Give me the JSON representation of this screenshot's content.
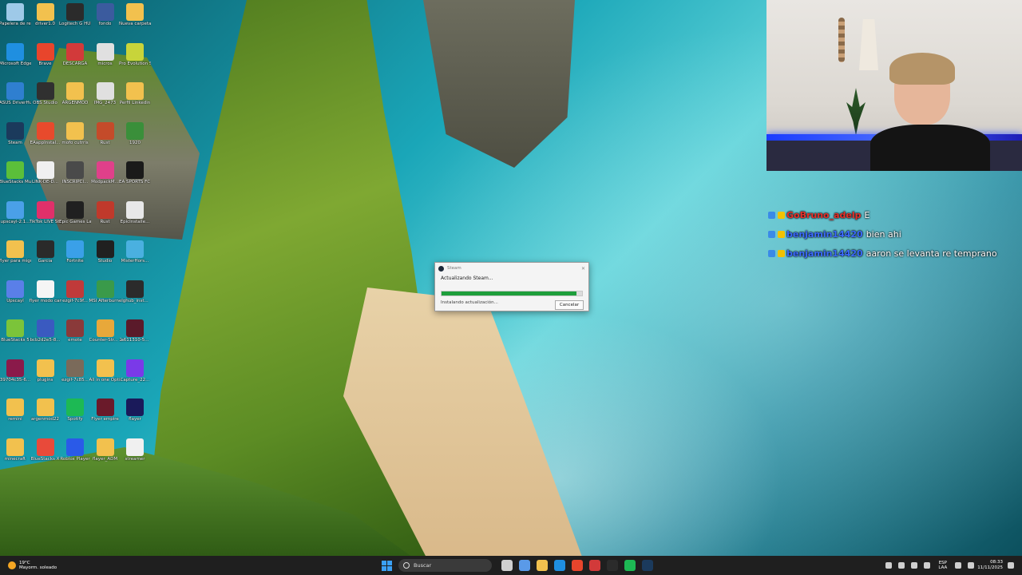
{
  "desktop": {
    "icons": [
      {
        "label": "Papelera de reciclaje",
        "color": "#9ec9e8"
      },
      {
        "label": "driver1.0",
        "color": "#f2c14e"
      },
      {
        "label": "Logitech G HUB",
        "color": "#2b2b2b"
      },
      {
        "label": "fondo",
        "color": "#3b5b9e"
      },
      {
        "label": "Nueva carpeta",
        "color": "#f2c14e"
      },
      {
        "label": "Microsoft Edge",
        "color": "#1f8fe0"
      },
      {
        "label": "Brave",
        "color": "#e8452c"
      },
      {
        "label": "DESCARGA",
        "color": "#d23a3a"
      },
      {
        "label": "micros",
        "color": "#e0e0e0"
      },
      {
        "label": "Pro Evolution Soccer",
        "color": "#c8d43a"
      },
      {
        "label": "ASUS DriverHub",
        "color": "#2f7fd0"
      },
      {
        "label": "OBS Studio",
        "color": "#303030"
      },
      {
        "label": "ARGENMOD",
        "color": "#f2c14e"
      },
      {
        "label": "IMG_2473",
        "color": "#e0e0e0"
      },
      {
        "label": "Perfil Linkedin",
        "color": "#f2c14e"
      },
      {
        "label": "Steam",
        "color": "#1b3a5c"
      },
      {
        "label": "EAappInstal...",
        "color": "#e84a2c"
      },
      {
        "label": "mofo cutrris",
        "color": "#f2c14e"
      },
      {
        "label": "Rust",
        "color": "#c44b2a"
      },
      {
        "label": "1920",
        "color": "#3a8f3a"
      },
      {
        "label": "BlueStacks Multi-Insta...",
        "color": "#5bbf3a"
      },
      {
        "label": "LINK-DE-D...",
        "color": "#f0f0f0"
      },
      {
        "label": "INSCRIPCI...",
        "color": "#4a4a4a"
      },
      {
        "label": "ModpackM...",
        "color": "#e0408a"
      },
      {
        "label": "EA SPORTS FC 25",
        "color": "#1a1a1a"
      },
      {
        "label": "upscayl-2.1...",
        "color": "#4aa0e8"
      },
      {
        "label": "TikTok LIVE Studio",
        "color": "#e0306a"
      },
      {
        "label": "Epic Games Launcher",
        "color": "#202020"
      },
      {
        "label": "Rust",
        "color": "#c0392b"
      },
      {
        "label": "EpicInstalle...",
        "color": "#e8e8e8"
      },
      {
        "label": "flyer para miguel",
        "color": "#f2c14e"
      },
      {
        "label": "Garcia",
        "color": "#2a2a2a"
      },
      {
        "label": "Fortnite",
        "color": "#3aa0e8"
      },
      {
        "label": "Studio",
        "color": "#202020"
      },
      {
        "label": "MisterHors...",
        "color": "#4ab0e0"
      },
      {
        "label": "Upscayl",
        "color": "#5a7fe8"
      },
      {
        "label": "flyer modo camera",
        "color": "#f5f5f5"
      },
      {
        "label": "ezgif-7c9f...",
        "color": "#c03a3a"
      },
      {
        "label": "MSI Afterburner",
        "color": "#3a9a4a"
      },
      {
        "label": "lghub_inst...",
        "color": "#2b2b2b"
      },
      {
        "label": "BlueStacks 5",
        "color": "#7bc43a"
      },
      {
        "label": "bcb2d2e5-8...",
        "color": "#3a5ac0"
      },
      {
        "label": "emote",
        "color": "#8a3a3a"
      },
      {
        "label": "Counter-Str... 2",
        "color": "#e8a83a"
      },
      {
        "label": "a611310-5...",
        "color": "#5a1a2a"
      },
      {
        "label": "39704c35-6...",
        "color": "#8a1a4a"
      },
      {
        "label": "plugins",
        "color": "#f2c14e"
      },
      {
        "label": "ezgif-7c85...",
        "color": "#7a6a5a"
      },
      {
        "label": "All in one Optimizer",
        "color": "#f2c14e"
      },
      {
        "label": "Capture_22...",
        "color": "#7a3ae8"
      },
      {
        "label": "remini",
        "color": "#f2c14e"
      },
      {
        "label": "argenmod22",
        "color": "#f2c14e"
      },
      {
        "label": "Spotify",
        "color": "#1db954"
      },
      {
        "label": "Flyer empire",
        "color": "#6a1a2a"
      },
      {
        "label": "flayer",
        "color": "#1a1a5a"
      },
      {
        "label": "minecraft",
        "color": "#f2c14e"
      },
      {
        "label": "BlueStacks X",
        "color": "#e84a3a"
      },
      {
        "label": "Roblox Player",
        "color": "#2a5ae8"
      },
      {
        "label": "flayer_ADM",
        "color": "#f2c14e"
      },
      {
        "label": "streamer",
        "color": "#f0f0f0"
      }
    ]
  },
  "dialog": {
    "title": "Steam",
    "close": "✕",
    "message": "Actualizando Steam...",
    "progress": 0.96,
    "status": "Instalando actualización...",
    "cancel_label": "Cancelar"
  },
  "chat": {
    "messages": [
      {
        "user": "GoBruno_adelp",
        "user_color": "#e8302a",
        "text": "E"
      },
      {
        "user": "benjamin14420",
        "user_color": "#3a6aff",
        "text": "bien ahi"
      },
      {
        "user": "benjamin14420",
        "user_color": "#3a6aff",
        "text": "aaron se levanta re temprano"
      }
    ]
  },
  "taskbar": {
    "weather_temp": "19°C",
    "weather_desc": "Mayorm. soleado",
    "search_placeholder": "Buscar",
    "lang_top": "ESP",
    "lang_bottom": "LAA",
    "time": "08:33",
    "date": "11/11/2025",
    "apps": [
      {
        "name": "task-view",
        "color": "#cfcfcf"
      },
      {
        "name": "widgets",
        "color": "#5a9ae8"
      },
      {
        "name": "file-explorer",
        "color": "#f2c14e"
      },
      {
        "name": "edge",
        "color": "#1f8fe0"
      },
      {
        "name": "brave",
        "color": "#e8452c"
      },
      {
        "name": "media",
        "color": "#d23a3a"
      },
      {
        "name": "ghub",
        "color": "#2b2b2b"
      },
      {
        "name": "spotify",
        "color": "#1db954"
      },
      {
        "name": "steam",
        "color": "#1b3a5c"
      }
    ]
  }
}
